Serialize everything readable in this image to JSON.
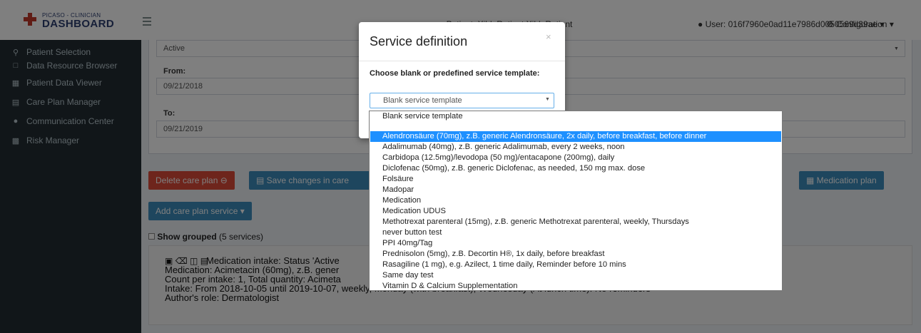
{
  "brand": {
    "line1": "PICASO - CLINICIAN",
    "line2": "DASHBOARD"
  },
  "sidebar": {
    "items": [
      {
        "label": "Patient Selection",
        "icon": "search-icon"
      },
      {
        "label": "Data Resource Browser",
        "icon": "folder-icon"
      },
      {
        "label": "Patient Data Viewer",
        "icon": "viewer-icon"
      },
      {
        "label": "Care Plan Manager",
        "icon": "document-icon"
      },
      {
        "label": "Communication Center",
        "icon": "chat-icon"
      },
      {
        "label": "Risk Manager",
        "icon": "table-icon"
      }
    ]
  },
  "topbar": {
    "patient": "Patient: XibleRatient XibleRatient",
    "user": "User: 016f7960e0ad11e7986d0050569d39ae",
    "config": "Configuration"
  },
  "form": {
    "status_value": "Active",
    "from_label": "From:",
    "from_value": "09/21/2018",
    "to_label": "To:",
    "to_value": "09/21/2019"
  },
  "buttons": {
    "delete": "Delete care plan",
    "save": "Save changes in care",
    "medication_plan": "Medication plan",
    "add_service": "Add care plan service"
  },
  "grouping": {
    "label": "Show grouped",
    "count": "(5 services)"
  },
  "service": {
    "line1": "Medication intake: Status 'Active",
    "line2": "Medication: Acimetacin (60mg), z.B. gener",
    "line3": "Count per intake: 1, Total quantity: Acimeta",
    "line4": "Intake: From 2018-10-05 until 2019-10-07, weekly, Monday (with breakfast), Wednesday (At lunch time). No reminders",
    "line5": "Author's role: Dermatologist"
  },
  "modal": {
    "title": "Service definition",
    "close": "×",
    "label": "Choose blank or predefined service template:",
    "selected": "Blank service template"
  },
  "dropdown": {
    "options": [
      "Blank service template",
      "",
      "Alendronsäure (70mg), z.B. generic Alendronsäure, 2x daily, before breakfast, before dinner",
      "Adalimumab (40mg), z.B. generic Adalimumab, every 2 weeks, noon",
      "Carbidopa (12.5mg)/levodopa (50 mg)/entacapone (200mg), daily",
      "Diclofenac (50mg), z.B. generic Diclofenac, as needed, 150 mg max. dose",
      "Folsäure",
      "Madopar",
      "Medication",
      "Medication UDUS",
      "Methotrexat parenteral (15mg), z.B. generic Methotrexat parenteral, weekly, Thursdays",
      "never button test",
      "PPI 40mg/Tag",
      "Prednisolon (5mg), z.B. Decortin H®, 1x daily, before breakfast",
      "Rasagiline (1 mg), e.g. Azilect, 1 time daily, Reminder before 10 mins",
      "Same day test",
      "Vitamin D & Calcium Supplementation"
    ],
    "selected_index": 2
  },
  "colors": {
    "sidebar_bg": "#222d32",
    "delete_btn": "#dd4b39",
    "primary_btn": "#3c8dbc",
    "highlight": "#1e90ff"
  }
}
